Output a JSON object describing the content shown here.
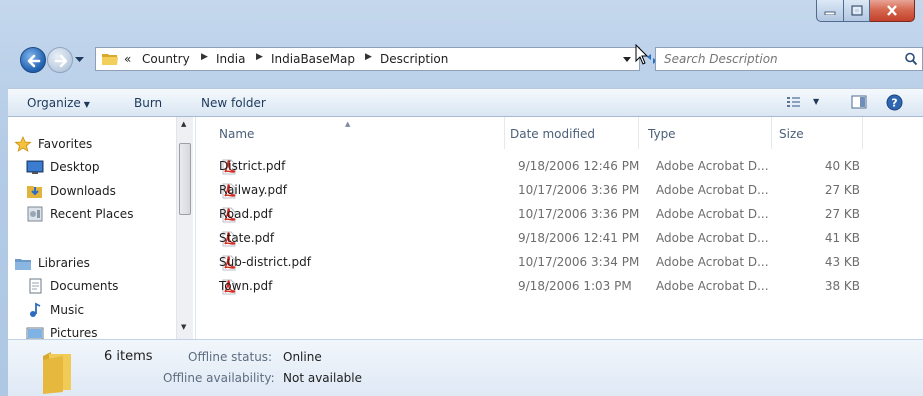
{
  "address": {
    "crumbs": [
      "«",
      "Country",
      "India",
      "IndiaBaseMap",
      "Description"
    ]
  },
  "search": {
    "placeholder": "Search Description"
  },
  "toolbar": {
    "organize": "Organize",
    "burn": "Burn",
    "new_folder": "New folder"
  },
  "navpane": {
    "items": [
      {
        "label": "Favorites",
        "icon": "star-icon"
      },
      {
        "label": "Desktop",
        "icon": "desktop-icon"
      },
      {
        "label": "Downloads",
        "icon": "downloads-icon"
      },
      {
        "label": "Recent Places",
        "icon": "recent-places-icon"
      },
      {
        "label": "Libraries",
        "icon": "libraries-icon"
      },
      {
        "label": "Documents",
        "icon": "documents-icon"
      },
      {
        "label": "Music",
        "icon": "music-icon"
      },
      {
        "label": "Pictures",
        "icon": "pictures-icon"
      }
    ]
  },
  "columns": {
    "name": "Name",
    "date": "Date modified",
    "type": "Type",
    "size": "Size"
  },
  "files": [
    {
      "name": "District.pdf",
      "date": "9/18/2006 12:46 PM",
      "type": "Adobe Acrobat D...",
      "size": "40 KB"
    },
    {
      "name": "Railway.pdf",
      "date": "10/17/2006 3:36 PM",
      "type": "Adobe Acrobat D...",
      "size": "27 KB"
    },
    {
      "name": "Road.pdf",
      "date": "10/17/2006 3:36 PM",
      "type": "Adobe Acrobat D...",
      "size": "27 KB"
    },
    {
      "name": "State.pdf",
      "date": "9/18/2006 12:41 PM",
      "type": "Adobe Acrobat D...",
      "size": "41 KB"
    },
    {
      "name": "Sub-district.pdf",
      "date": "10/17/2006 3:34 PM",
      "type": "Adobe Acrobat D...",
      "size": "43 KB"
    },
    {
      "name": "Town.pdf",
      "date": "9/18/2006 1:03 PM",
      "type": "Adobe Acrobat D...",
      "size": "38 KB"
    }
  ],
  "details": {
    "count": "6 items",
    "offline_status_label": "Offline status:",
    "offline_status_value": "Online",
    "offline_avail_label": "Offline availability:",
    "offline_avail_value": "Not available"
  },
  "colors": {
    "accent": "#1e395b",
    "pdf_red": "#d4291f",
    "folder": "#e8c04a"
  }
}
